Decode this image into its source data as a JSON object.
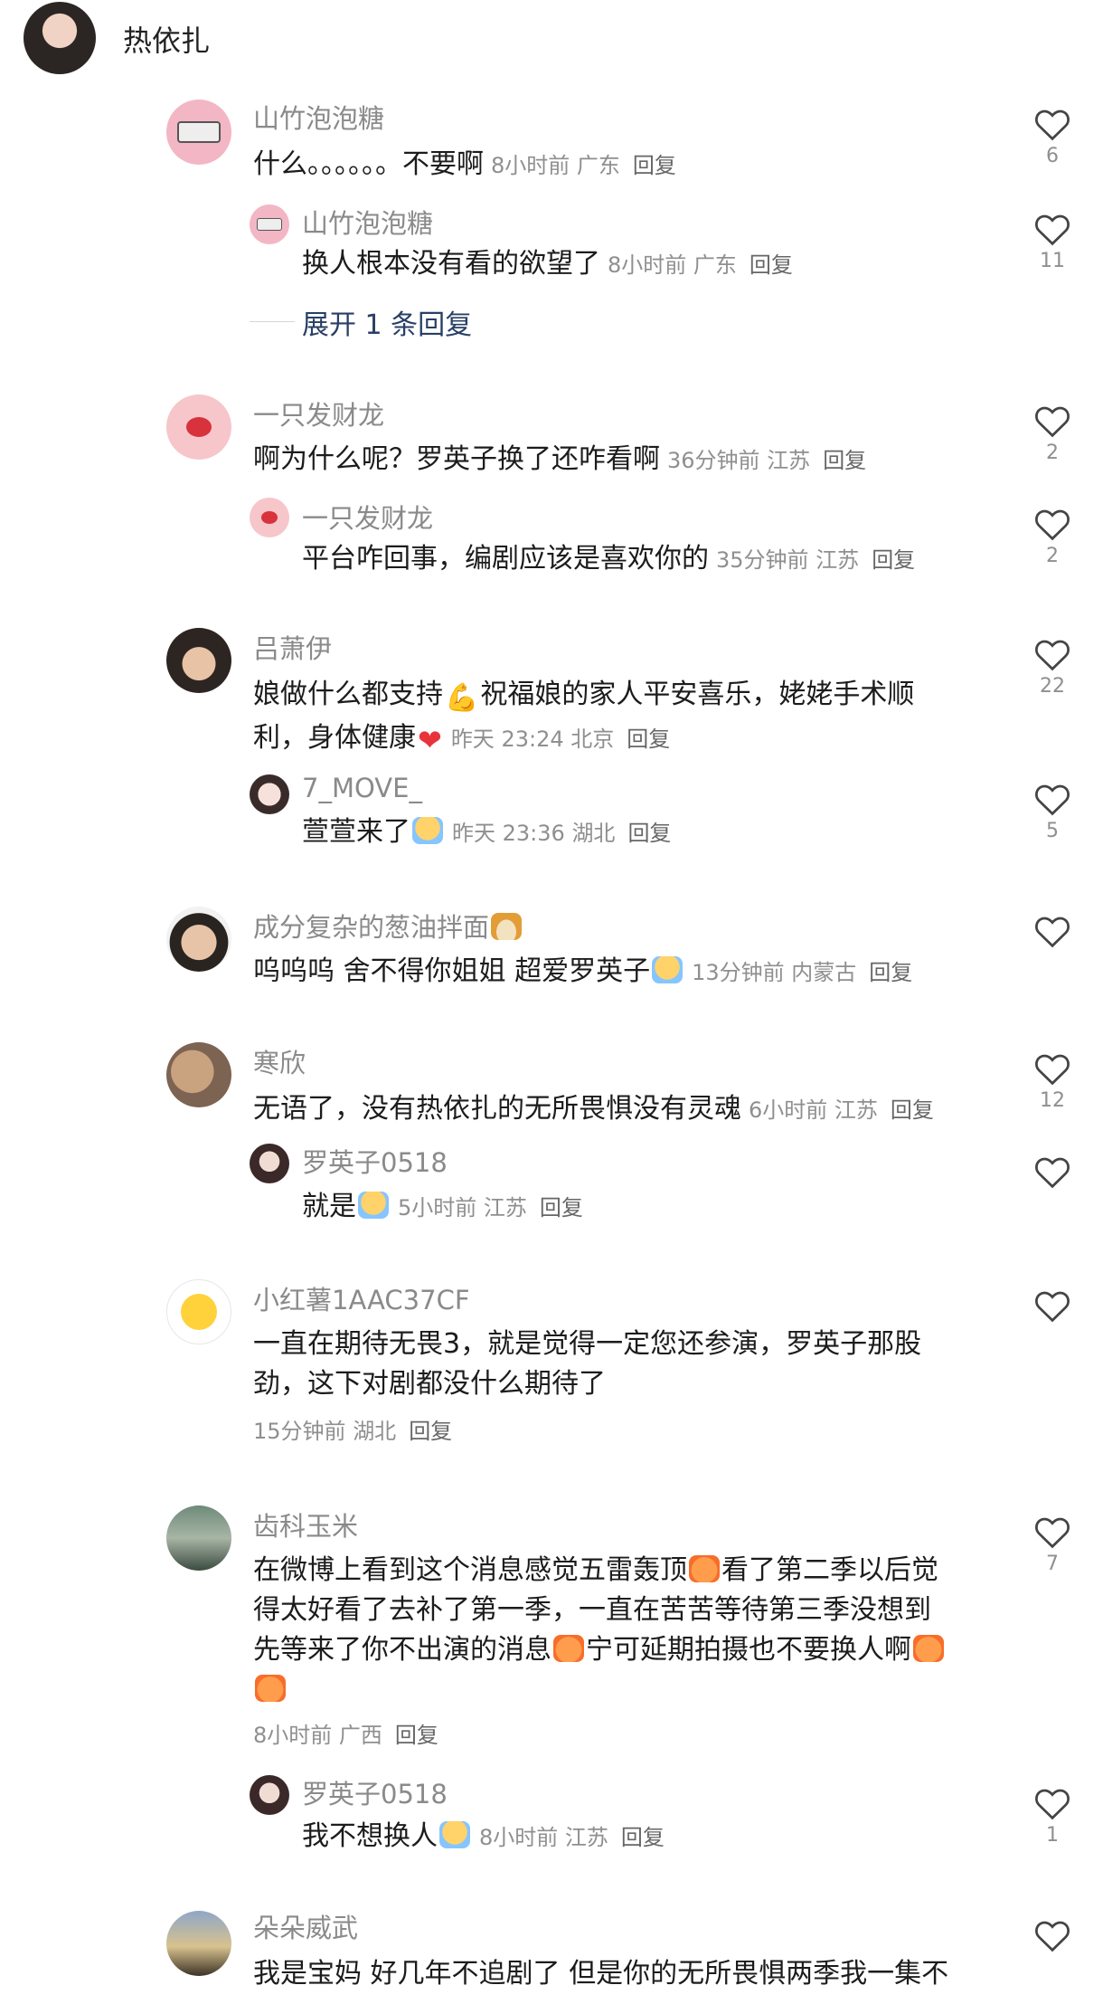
{
  "post": {
    "username": "热依扎"
  },
  "comments": [
    {
      "username": "山竹泡泡糖",
      "text": "什么。。。。。。不要啊",
      "time": "8小时前",
      "location": "广东",
      "reply": "回复",
      "likes": "6",
      "replies": [
        {
          "username": "山竹泡泡糖",
          "text": "换人根本没有看的欲望了",
          "time": "8小时前",
          "location": "广东",
          "reply": "回复",
          "likes": "11"
        }
      ],
      "expand": "展开 1 条回复"
    },
    {
      "username": "一只发财龙",
      "text": "啊为什么呢？罗英子换了还咋看啊",
      "time": "36分钟前",
      "location": "江苏",
      "reply": "回复",
      "likes": "2",
      "replies": [
        {
          "username": "一只发财龙",
          "text": "平台咋回事，编剧应该是喜欢你的",
          "time": "35分钟前",
          "location": "江苏",
          "reply": "回复",
          "likes": "2"
        }
      ]
    },
    {
      "username": "吕萧伊",
      "text_line1": "娘做什么都支持",
      "text_line1b": "祝福娘的家人平安喜乐，姥姥手术顺",
      "text_line2": "利，身体健康",
      "time": "昨天 23:24",
      "location": "北京",
      "reply": "回复",
      "likes": "22",
      "replies": [
        {
          "username": "7_MOVE_",
          "text": "萱萱来了",
          "time": "昨天 23:36",
          "location": "湖北",
          "reply": "回复",
          "likes": "5"
        }
      ]
    },
    {
      "username": "成分复杂的葱油拌面",
      "text": "呜呜呜 舍不得你姐姐 超爱罗英子",
      "time": "13分钟前",
      "location": "内蒙古",
      "reply": "回复",
      "likes": ""
    },
    {
      "username": "寒欣",
      "text": "无语了，没有热依扎的无所畏惧没有灵魂",
      "time": "6小时前",
      "location": "江苏",
      "reply": "回复",
      "likes": "12",
      "replies": [
        {
          "username": "罗英子0518",
          "text": "就是",
          "time": "5小时前",
          "location": "江苏",
          "reply": "回复",
          "likes": ""
        }
      ]
    },
    {
      "username": "小红薯1AAC37CF",
      "text_line1": "一直在期待无畏3，就是觉得一定您还参演，罗英子那股",
      "text_line2": "劲，这下对剧都没什么期待了",
      "time": "15分钟前",
      "location": "湖北",
      "reply": "回复",
      "likes": ""
    },
    {
      "username": "齿科玉米",
      "text_line1": "在微博上看到这个消息感觉五雷轰顶",
      "text_line1b": "看了第二季以后觉",
      "text_line2": "得太好看了去补了第一季，一直在苦苦等待第三季没想到",
      "text_line3": "先等来了你不出演的消息",
      "text_line3b": "宁可延期拍摄也不要换人啊",
      "time": "8小时前",
      "location": "广西",
      "reply": "回复",
      "likes": "7",
      "replies": [
        {
          "username": "罗英子0518",
          "text": "我不想换人",
          "time": "8小时前",
          "location": "江苏",
          "reply": "回复",
          "likes": "1"
        }
      ]
    },
    {
      "username": "朵朵威武",
      "text_line1": "我是宝妈 好几年不追剧了 但是你的无所畏惧两季我一集不",
      "likes": ""
    }
  ],
  "colors": {
    "username": "#8a8a8a",
    "meta": "#8f8f8f",
    "expand": "#283f66"
  },
  "icons": {
    "like": "heart-outline-icon"
  }
}
